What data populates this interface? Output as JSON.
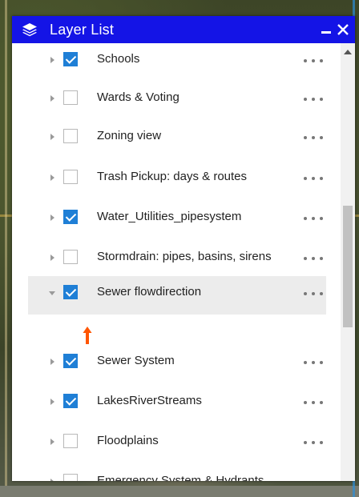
{
  "panel": {
    "title": "Layer List",
    "minimize_label": "−",
    "close_label": "✕",
    "title_icon": "layers-icon"
  },
  "layers": [
    {
      "label": "Schools",
      "checked": true,
      "expanded": false
    },
    {
      "label": "Wards & Voting",
      "checked": false,
      "expanded": false
    },
    {
      "label": "Zoning view",
      "checked": false,
      "expanded": false
    },
    {
      "label": "Trash Pickup: days & routes",
      "checked": false,
      "expanded": false
    },
    {
      "label": "Water_Utilities_pipesystem",
      "checked": true,
      "expanded": false
    },
    {
      "label": "Stormdrain: pipes, basins, sirens",
      "checked": false,
      "expanded": false
    },
    {
      "label": "Sewer flowdirection",
      "checked": true,
      "expanded": true,
      "selected": true
    },
    {
      "label": "Sewer System",
      "checked": true,
      "expanded": false
    },
    {
      "label": "LakesRiverStreams",
      "checked": true,
      "expanded": false
    },
    {
      "label": "Floodplains",
      "checked": false,
      "expanded": false
    },
    {
      "label": "Emergency System & Hydrants",
      "checked": false,
      "expanded": false
    }
  ],
  "colors": {
    "title_bar": "#1414e6",
    "checkbox_checked": "#1f7fd6",
    "arrow_indicator": "#ff5500"
  },
  "icons": {
    "more_options": "more-options-icon",
    "expand": "caret-right-icon",
    "collapse": "caret-down-icon",
    "legend": "arrow-up-icon"
  }
}
